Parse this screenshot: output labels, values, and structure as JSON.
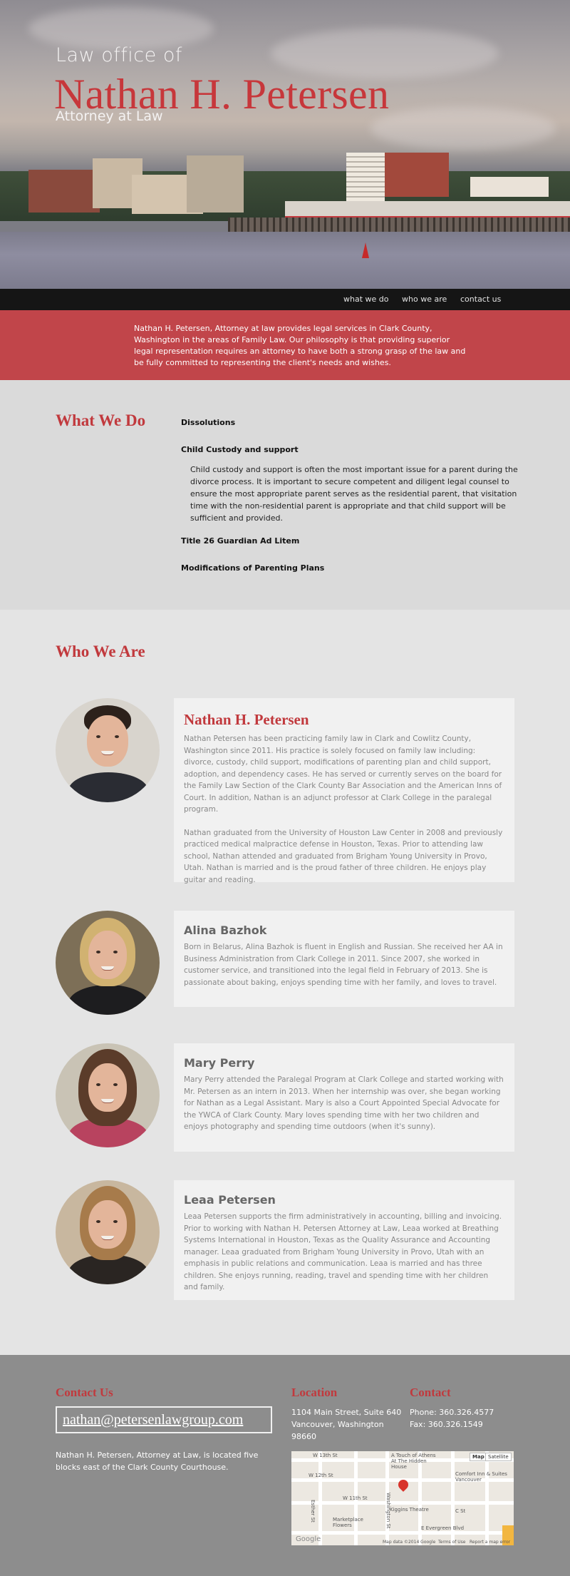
{
  "hero": {
    "subtitle": "Law office of",
    "name": "Nathan H. Petersen",
    "tagline": "Attorney at Law"
  },
  "nav": {
    "items": [
      "what we do",
      "who we are",
      "contact us"
    ]
  },
  "intro": {
    "text": "Nathan H. Petersen, Attorney at law provides legal services in Clark County, Washington in the areas of Family Law. Our philosophy is that providing superior legal representation requires an attorney to have both a strong grasp of the law and be fully committed to representing the client's needs and wishes."
  },
  "what_we_do": {
    "heading": "What We Do",
    "services": [
      "Dissolutions",
      "Child Custody and support",
      "Title 26 Guardian Ad Litem",
      "Modifications of Parenting Plans"
    ],
    "custody_description": "Child custody and support is often the most important issue for a parent during the divorce process. It is important to secure competent and diligent legal counsel to ensure the most appropriate parent serves as the residential parent, that visitation time with the non-residential parent is appropriate and that child support will be sufficient and provided."
  },
  "who_we_are": {
    "heading": "Who We Are",
    "people": [
      {
        "name": "Nathan H. Petersen",
        "paragraphs": [
          "Nathan Petersen has been practicing family law in Clark and Cowlitz County, Washington since 2011. His practice is solely focused on family law including: divorce, custody, child support, modifications of parenting plan and child support, adoption, and dependency cases. He has served or currently serves on the board for the Family Law Section of the Clark County Bar Association and the American Inns of Court. In addition, Nathan is an adjunct professor at Clark College in the paralegal program.",
          "Nathan graduated from the University of Houston Law Center in 2008 and previously practiced medical malpractice defense in Houston, Texas. Prior to attending law school, Nathan attended and graduated from Brigham Young University in Provo, Utah. Nathan is married and is the proud father of three children. He enjoys play guitar and reading."
        ]
      },
      {
        "name": "Alina Bazhok",
        "paragraphs": [
          "Born in Belarus, Alina Bazhok is fluent in English and Russian. She received her AA in Business Administration from Clark College in 2011. Since 2007, she worked in customer service, and transitioned into the legal field in February of 2013. She is passionate about baking, enjoys spending time with her family, and loves to travel."
        ]
      },
      {
        "name": "Mary Perry",
        "paragraphs": [
          "Mary Perry attended the Paralegal Program at Clark College and started working with Mr. Petersen as an intern in 2013. When her internship was over, she began working for Nathan as a Legal Assistant. Mary is also a Court Appointed Special Advocate for the YWCA of Clark County. Mary loves spending time with her two children and enjoys photography and spending time outdoors (when it's sunny)."
        ]
      },
      {
        "name": "Leaa Petersen",
        "paragraphs": [
          "Leaa Petersen supports the firm administratively in accounting, billing and invoicing. Prior to working with Nathan H. Petersen Attorney at Law, Leaa worked at Breathing Systems International in Houston, Texas as the Quality Assurance and Accounting manager. Leaa graduated from Brigham Young University in Provo, Utah with an emphasis in public relations and communication. Leaa is married and has three children. She enjoys running, reading, travel and spending time with her children and family."
        ]
      }
    ]
  },
  "footer": {
    "contact_us_heading": "Contact Us",
    "email": "nathan@petersenlawgroup.com",
    "note": "Nathan H. Petersen, Attorney at Law, is located five blocks east of the Clark County Courthouse.",
    "location_heading": "Location",
    "address": [
      "1104 Main Street, Suite 640",
      "Vancouver, Washington",
      "98660"
    ],
    "contact_heading": "Contact",
    "phone": "Phone: 360.326.4577",
    "fax": "Fax: 360.326.1549",
    "map": {
      "btn_map": "Map",
      "btn_satellite": "Satellite",
      "labels": [
        "W 13th St",
        "W 12th St",
        "W 11th St",
        "E Evergreen Blvd",
        "Washington St",
        "Esther St",
        "C St",
        "A Touch of Athens At The Hidden House",
        "Comfort Inn & Suites Vancouver",
        "Kiggins Theatre",
        "Marketplace Flowers",
        "Google",
        "Map data ©2014 Google",
        "Terms of Use",
        "Report a map error"
      ]
    }
  }
}
